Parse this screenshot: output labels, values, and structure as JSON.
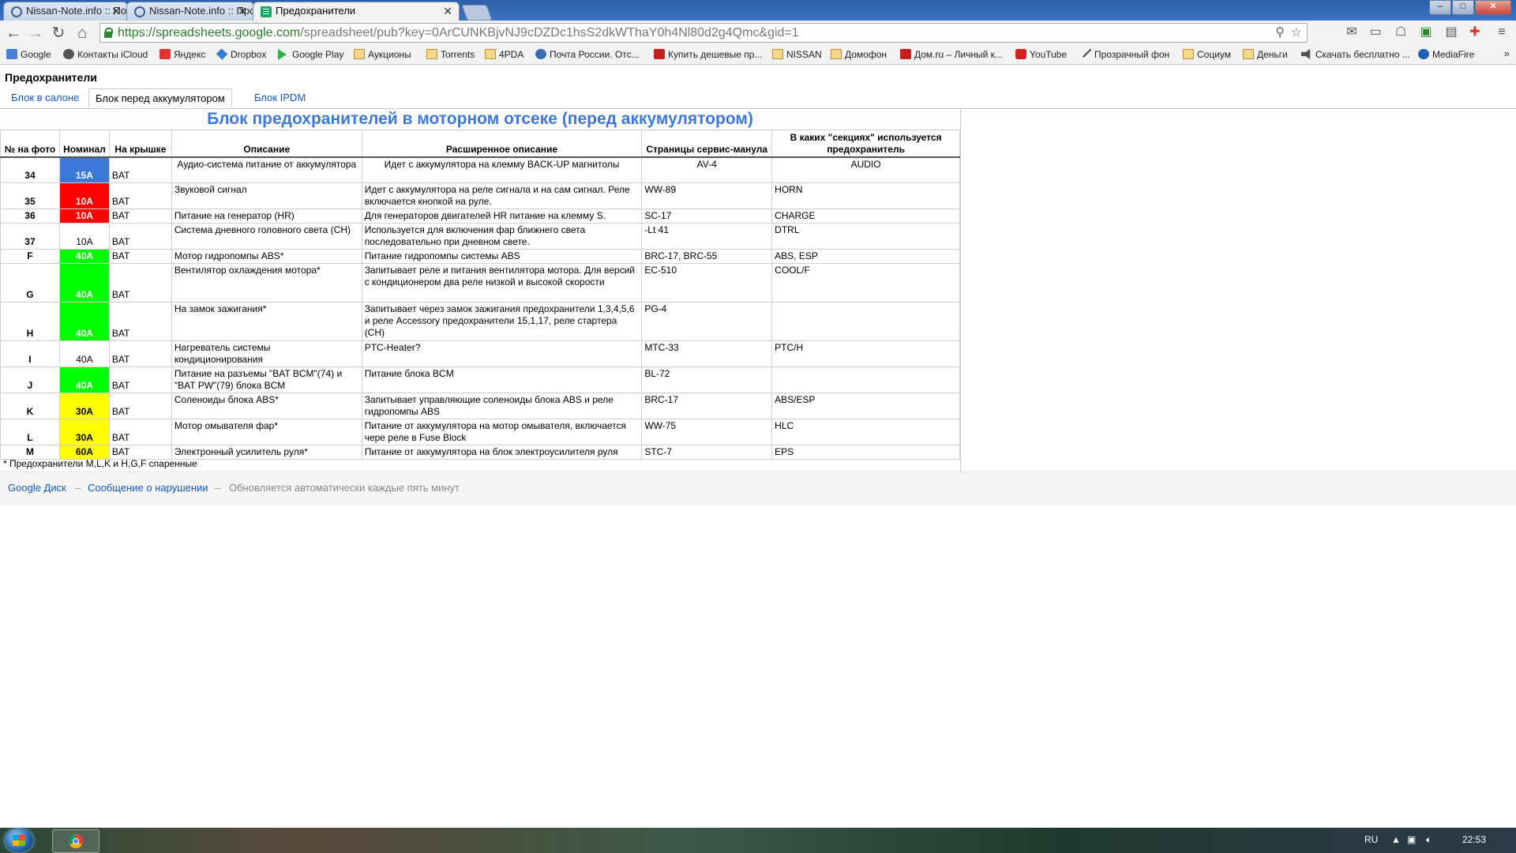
{
  "browser": {
    "tabs": [
      {
        "title": "Nissan-Note.info :: Поиск",
        "active": false
      },
      {
        "title": "Nissan-Note.info :: Прос…",
        "active": false
      },
      {
        "title": "Предохранители",
        "active": true
      }
    ],
    "url_host": "https://spreadsheets.google.com",
    "url_rest": "/spreadsheet/pub?key=0ArCUNKBjvNJ9cDZDc1hsS2dkWThaY0h4Nl80d2g4Qmc&gid=1",
    "bookmarks": [
      {
        "label": "Google",
        "icon": "google-icon"
      },
      {
        "label": "Контакты iCloud",
        "icon": "apple-icon"
      },
      {
        "label": "Яндекс",
        "icon": "yandex-icon"
      },
      {
        "label": "Dropbox",
        "icon": "dropbox-icon"
      },
      {
        "label": "Google Play",
        "icon": "play-icon"
      },
      {
        "label": "Аукционы",
        "icon": "folder-icon"
      },
      {
        "label": "Torrents",
        "icon": "folder-icon"
      },
      {
        "label": "4PDA",
        "icon": "folder-icon"
      },
      {
        "label": "Почта России. Отс...",
        "icon": "post-icon"
      },
      {
        "label": "Купить дешевые пр...",
        "icon": "shop-icon"
      },
      {
        "label": "NISSAN",
        "icon": "folder-icon"
      },
      {
        "label": "Домофон",
        "icon": "folder-icon"
      },
      {
        "label": "Дом.ru – Личный к...",
        "icon": "domru-icon"
      },
      {
        "label": "YouTube",
        "icon": "youtube-icon"
      },
      {
        "label": "Прозрачный фон",
        "icon": "pen-icon"
      },
      {
        "label": "Социум",
        "icon": "folder-icon"
      },
      {
        "label": "Деньги",
        "icon": "folder-icon"
      },
      {
        "label": "Скачать бесплатно ...",
        "icon": "speaker-icon"
      },
      {
        "label": "MediaFire",
        "icon": "mediafire-icon"
      }
    ],
    "bookmarks_more": "»"
  },
  "page": {
    "doc_title": "Предохранители",
    "sheet_tabs": [
      {
        "label": "Блок в салоне",
        "active": false
      },
      {
        "label": "Блок перед аккумулятором",
        "active": true
      },
      {
        "label": "Блок IPDM",
        "active": false
      }
    ],
    "sheet_title": "Блок предохранителей в моторном отсеке (перед аккумулятором)",
    "columns": [
      "№ на фото",
      "Номинал",
      "На крышке",
      "Описание",
      "Расширенное описание",
      "Страницы сервис-манула",
      "В каких \"секциях\" используется предохранитель"
    ],
    "rows": [
      {
        "num": "34",
        "rating": "15A",
        "color": "#3c78d8",
        "cover": "BAT",
        "desc": "Аудио-система питание от аккумулятора",
        "ext": "Идет с аккумулятора на клемму BACK-UP магнитолы",
        "pages": "AV-4",
        "sections": "AUDIO"
      },
      {
        "num": "35",
        "rating": "10A",
        "color": "#ff0000",
        "cover": "BAT",
        "desc": "Звуковой сигнал",
        "ext": "Идет с аккумулятора на реле сигнала и на сам сигнал. Реле включается кнопкой на руле.",
        "pages": "WW-89",
        "sections": "HORN"
      },
      {
        "num": "36",
        "rating": "10A",
        "color": "#ff0000",
        "cover": "BAT",
        "desc": "Питание на генератор (HR)",
        "ext": "Для генераторов двигателей HR питание на клемму S.",
        "pages": "SC-17",
        "sections": "CHARGE"
      },
      {
        "num": "37",
        "rating": "10A",
        "color": "",
        "cover": "BAT",
        "desc": "Система дневного головного света (CH)",
        "ext": "Используется для включения фар ближнего света последовательно при дневном свете.",
        "pages": "-Lt 41",
        "sections": "DTRL"
      },
      {
        "num": "F",
        "rating": "40A",
        "color": "#00ff00",
        "cover": "BAT",
        "desc": "Мотор гидропомпы ABS*",
        "ext": "Питание гидропомпы системы ABS",
        "pages": "BRC-17, BRC-55",
        "sections": "ABS, ESP"
      },
      {
        "num": "G",
        "rating": "40A",
        "color": "#00ff00",
        "cover": "BAT",
        "desc": "Вентилятор охлаждения мотора*",
        "ext": "Запитывает реле и питания вентилятора мотора. Для версий с кондиционером два реле низкой и высокой скорости",
        "pages": "EC-510",
        "sections": "COOL/F"
      },
      {
        "num": "H",
        "rating": "40A",
        "color": "#00ff00",
        "cover": "BAT",
        "desc": "На замок зажигания*",
        "ext": "Запитывает через замок зажигания предохранители 1,3,4,5,6 и реле Accessory предохранители 15,1,17, реле стартера (CH)",
        "pages": "PG-4",
        "sections": ""
      },
      {
        "num": "I",
        "rating": "40A",
        "color": "",
        "cover": "BAT",
        "desc": "Нагреватель системы кондиционирования",
        "ext": "PTC-Heater?",
        "pages": "MTC-33",
        "sections": "PTC/H"
      },
      {
        "num": "J",
        "rating": "40A",
        "color": "#00ff00",
        "cover": "BAT",
        "desc": "Питание на разъемы \"BAT BCM\"(74) и \"BAT PW\"(79) блока BCM",
        "ext": "Питание блока BCM",
        "pages": "BL-72",
        "sections": ""
      },
      {
        "num": "K",
        "rating": "30A",
        "color": "#ffff00",
        "cover": "BAT",
        "desc": "Соленоиды блока ABS*",
        "ext": "Запитывает управляющие соленоиды блока ABS и реле гидропомпы ABS",
        "pages": "BRC-17",
        "sections": "ABS/ESP"
      },
      {
        "num": "L",
        "rating": "30A",
        "color": "#ffff00",
        "cover": "BAT",
        "desc": "Мотор омывателя фар*",
        "ext": "Питание от аккумулятора на мотор омывателя, включается чере реле в Fuse Block",
        "pages": "WW-75",
        "sections": "HLC"
      },
      {
        "num": "M",
        "rating": "60A",
        "color": "#ffff00",
        "cover": "BAT",
        "desc": "Электронный усилитель руля*",
        "ext": "Питание от аккумулятора на блок электроусилителя руля",
        "pages": "STC-7",
        "sections": "EPS"
      }
    ],
    "footnote": "* Предохранители M,L,K и H,G,F спаренные"
  },
  "footer": {
    "drive_link": "Google Диск",
    "report_link": "Сообщение о нарушении",
    "separator": "–",
    "autoupdate": "Обновляется автоматически каждые пять минут"
  },
  "taskbar": {
    "language": "RU",
    "clock": "22:53"
  }
}
